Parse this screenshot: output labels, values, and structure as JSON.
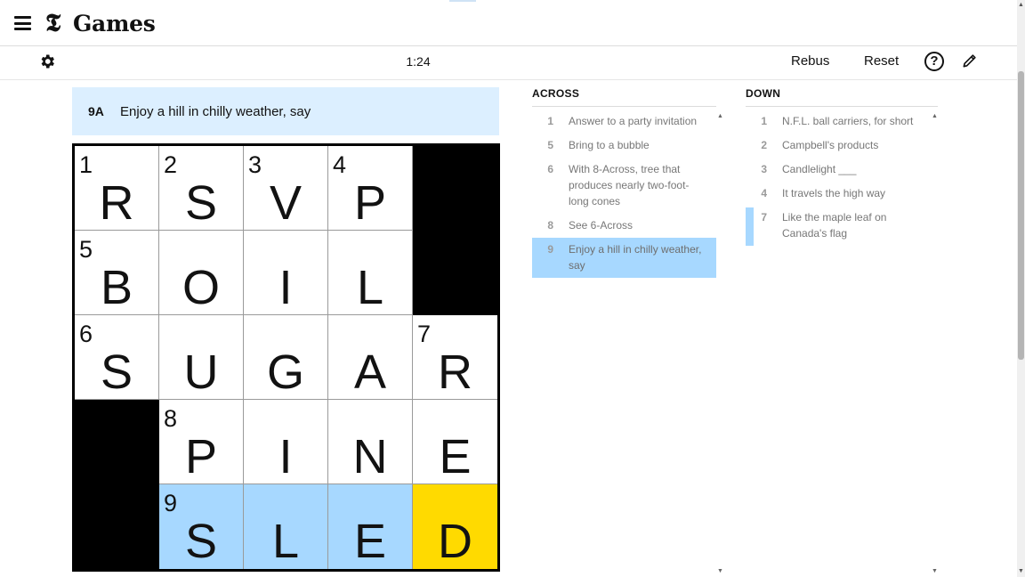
{
  "header": {
    "logo_letter": "𝕿",
    "logo_text": "Games",
    "menu_icon": "hamburger-icon"
  },
  "toolbar": {
    "settings_icon": "gear-icon",
    "timer": "1:24",
    "rebus_label": "Rebus",
    "reset_label": "Reset",
    "help_label": "?",
    "pencil_icon": "pencil-icon"
  },
  "current_clue": {
    "label": "9A",
    "text": "Enjoy a hill in chilly weather, say"
  },
  "grid": [
    [
      {
        "n": "1",
        "l": "R"
      },
      {
        "n": "2",
        "l": "S"
      },
      {
        "n": "3",
        "l": "V"
      },
      {
        "n": "4",
        "l": "P"
      },
      {
        "block": true
      }
    ],
    [
      {
        "n": "5",
        "l": "B"
      },
      {
        "n": "",
        "l": "O"
      },
      {
        "n": "",
        "l": "I"
      },
      {
        "n": "",
        "l": "L"
      },
      {
        "block": true
      }
    ],
    [
      {
        "n": "6",
        "l": "S"
      },
      {
        "n": "",
        "l": "U"
      },
      {
        "n": "",
        "l": "G"
      },
      {
        "n": "",
        "l": "A"
      },
      {
        "n": "7",
        "l": "R"
      }
    ],
    [
      {
        "block": true
      },
      {
        "n": "8",
        "l": "P"
      },
      {
        "n": "",
        "l": "I"
      },
      {
        "n": "",
        "l": "N"
      },
      {
        "n": "",
        "l": "E"
      }
    ],
    [
      {
        "block": true
      },
      {
        "n": "9",
        "l": "S",
        "word": true
      },
      {
        "n": "",
        "l": "L",
        "word": true
      },
      {
        "n": "",
        "l": "E",
        "word": true
      },
      {
        "n": "",
        "l": "D",
        "sel": true
      }
    ]
  ],
  "across": {
    "title": "ACROSS",
    "clues": [
      {
        "num": "1",
        "text": "Answer to a party invitation"
      },
      {
        "num": "5",
        "text": "Bring to a bubble"
      },
      {
        "num": "6",
        "text": "With 8-Across, tree that produces nearly two-foot-long cones"
      },
      {
        "num": "8",
        "text": "See 6-Across"
      },
      {
        "num": "9",
        "text": "Enjoy a hill in chilly weather, say",
        "active": true
      }
    ]
  },
  "down": {
    "title": "DOWN",
    "clues": [
      {
        "num": "1",
        "text": "N.F.L. ball carriers, for short"
      },
      {
        "num": "2",
        "text": "Campbell's products"
      },
      {
        "num": "3",
        "text": "Candlelight ___"
      },
      {
        "num": "4",
        "text": "It travels the high way"
      },
      {
        "num": "7",
        "text": "Like the maple leaf on Canada's flag",
        "cross": true
      }
    ]
  }
}
